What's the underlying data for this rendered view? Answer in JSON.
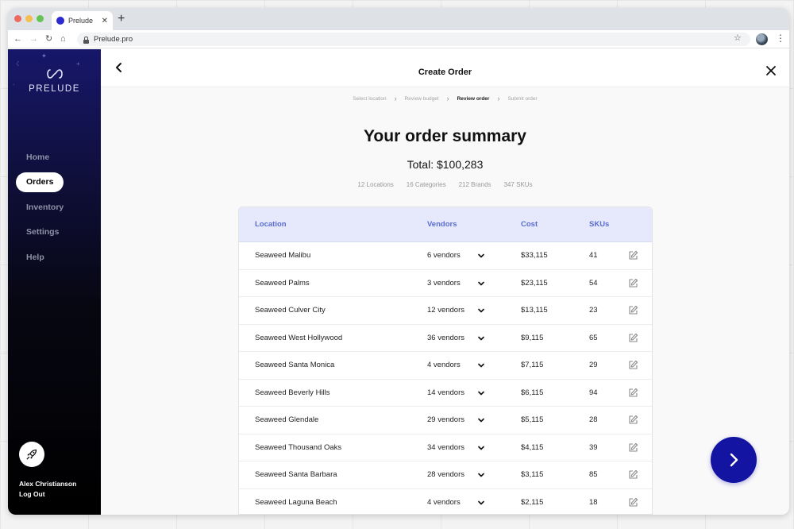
{
  "browser": {
    "tab_title": "Prelude",
    "tab_close": "✕",
    "new_tab": "+",
    "url": "Prelude.pro",
    "icons": [
      "back-icon",
      "forward-icon",
      "reload-icon",
      "home-icon",
      "lock-icon",
      "star-icon",
      "profile-avatar",
      "kebab-icon"
    ]
  },
  "sidebar": {
    "logo_text": "PRELUDE",
    "nav": [
      {
        "label": "Home",
        "active": false
      },
      {
        "label": "Orders",
        "active": true
      },
      {
        "label": "Inventory",
        "active": false
      },
      {
        "label": "Settings",
        "active": false
      },
      {
        "label": "Help",
        "active": false
      }
    ],
    "user_name": "Alex Christianson",
    "logout_label": "Log Out"
  },
  "header": {
    "title": "Create Order"
  },
  "steps": [
    "Select location",
    "Review budget",
    "Review order",
    "Submit order"
  ],
  "current_step": "Review order",
  "summary": {
    "title": "Your order summary",
    "total": "Total: $100,283",
    "stats": [
      "12 Locations",
      "16 Categories",
      "212 Brands",
      "347 SKUs"
    ]
  },
  "table": {
    "columns": [
      "Location",
      "Vendors",
      "Cost",
      "SKUs"
    ],
    "rows": [
      {
        "location": "Seaweed Malibu",
        "vendors": "6 vendors",
        "cost": "$33,115",
        "skus": "41"
      },
      {
        "location": "Seaweed Palms",
        "vendors": "3 vendors",
        "cost": "$23,115",
        "skus": "54"
      },
      {
        "location": "Seaweed Culver City",
        "vendors": "12 vendors",
        "cost": "$13,115",
        "skus": "23"
      },
      {
        "location": "Seaweed West Hollywood",
        "vendors": "36 vendors",
        "cost": "$9,115",
        "skus": "65"
      },
      {
        "location": "Seaweed Santa Monica",
        "vendors": "4 vendors",
        "cost": "$7,115",
        "skus": "29"
      },
      {
        "location": "Seaweed Beverly Hills",
        "vendors": "14 vendors",
        "cost": "$6,115",
        "skus": "94"
      },
      {
        "location": "Seaweed Glendale",
        "vendors": "29 vendors",
        "cost": "$5,115",
        "skus": "28"
      },
      {
        "location": "Seaweed Thousand Oaks",
        "vendors": "34 vendors",
        "cost": "$4,115",
        "skus": "39"
      },
      {
        "location": "Seaweed Santa Barbara",
        "vendors": "28 vendors",
        "cost": "$3,115",
        "skus": "85"
      },
      {
        "location": "Seaweed Laguna Beach",
        "vendors": "4 vendors",
        "cost": "$2,115",
        "skus": "18"
      }
    ]
  },
  "colors": {
    "accent": "#1414a3",
    "table_header_bg": "#e5e9fb",
    "table_header_text": "#5b6ccf",
    "sidebar_top": "#17176b",
    "sidebar_bottom": "#000000"
  }
}
